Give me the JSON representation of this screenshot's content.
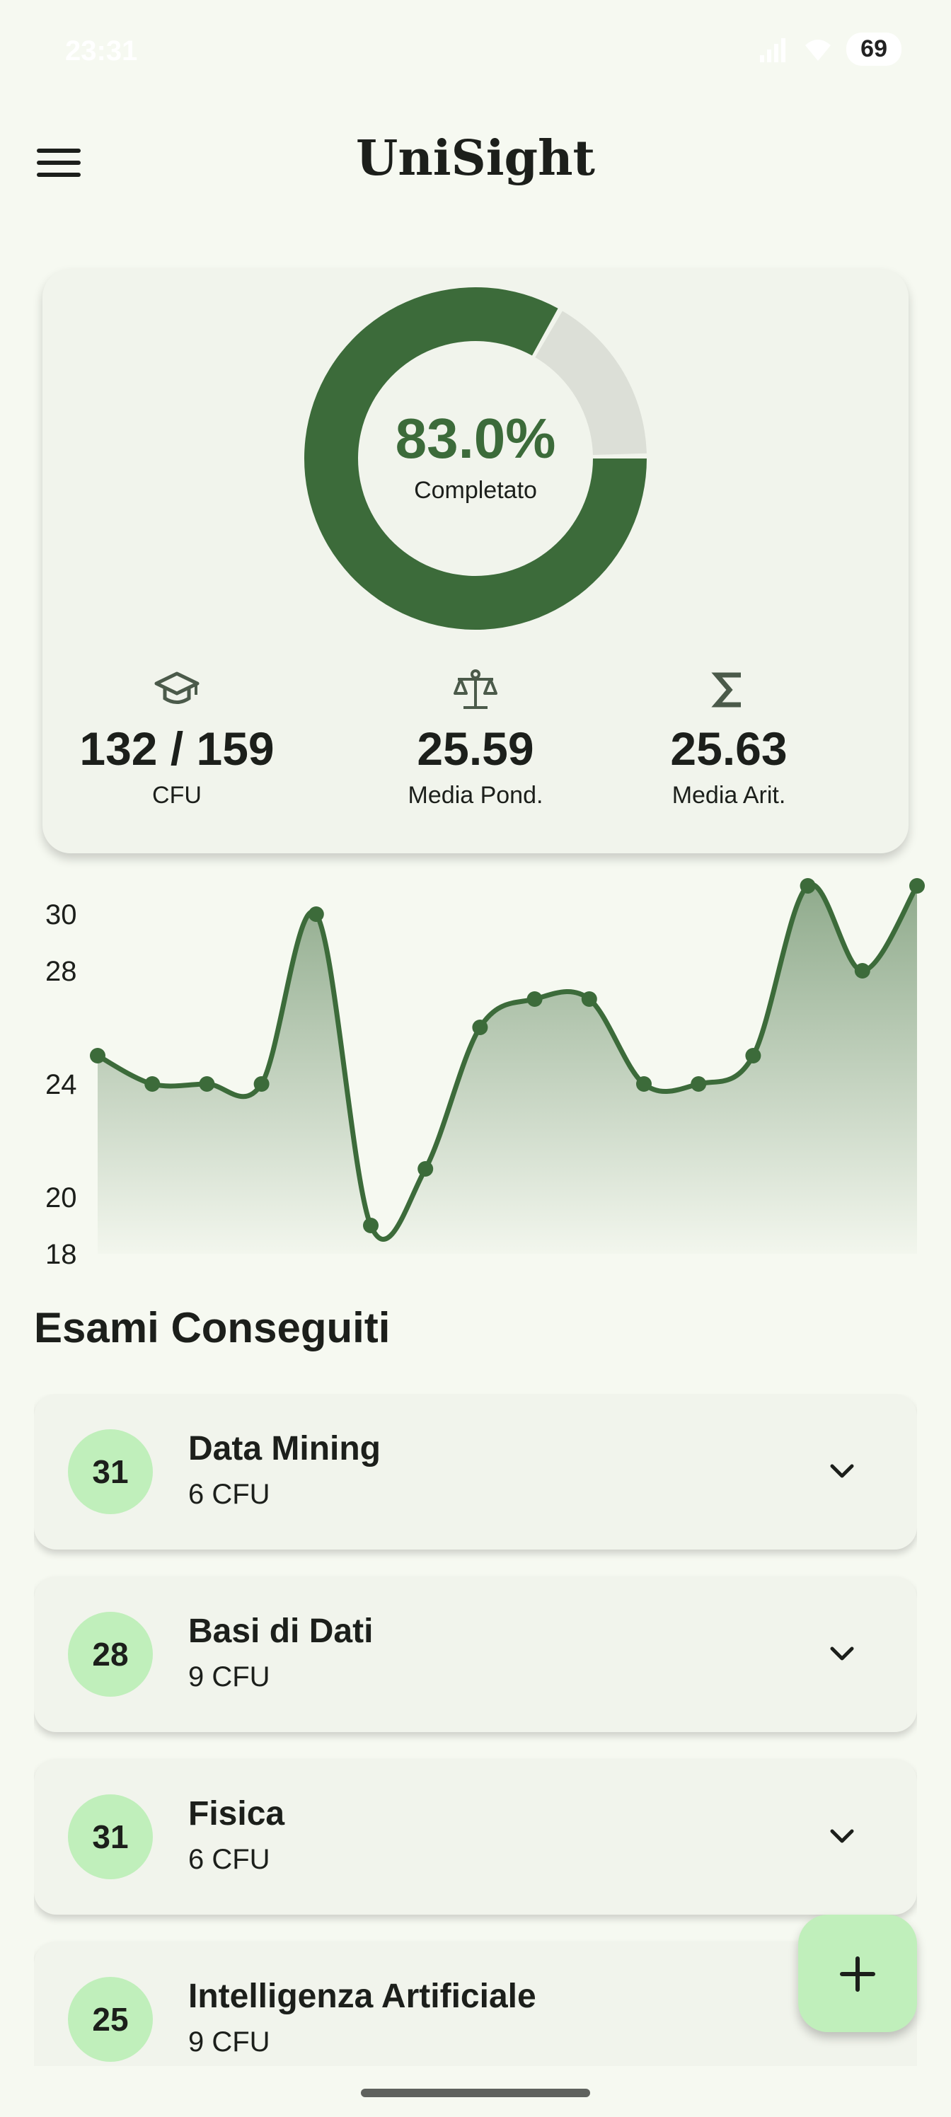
{
  "status_bar": {
    "time": "23:31",
    "battery": "69"
  },
  "header": {
    "title": "UniSight",
    "menu_icon": "menu-icon"
  },
  "summary": {
    "progress_percent": 83.0,
    "percent_text": "83.0%",
    "percent_label": "Completato",
    "stats": [
      {
        "icon": "graduation-cap-icon",
        "value": "132 / 159",
        "label": "CFU"
      },
      {
        "icon": "scale-icon",
        "value": "25.59",
        "label": "Media Pond."
      },
      {
        "icon": "sigma-icon",
        "value": "25.63",
        "label": "Media Arit."
      }
    ]
  },
  "chart_data": {
    "type": "line",
    "y_ticks": [
      18,
      20,
      24,
      28,
      30
    ],
    "ylim": [
      18,
      31
    ],
    "values": [
      25,
      24,
      24,
      24,
      30,
      19,
      21,
      26,
      27,
      27,
      24,
      24,
      25,
      31,
      28,
      31
    ],
    "color": "#3c6b3a",
    "area_fill": true,
    "grid": false
  },
  "exams": {
    "title": "Esami Conseguiti",
    "items": [
      {
        "grade": "31",
        "name": "Data Mining",
        "cfu": "6 CFU"
      },
      {
        "grade": "28",
        "name": "Basi di Dati",
        "cfu": "9 CFU"
      },
      {
        "grade": "31",
        "name": "Fisica",
        "cfu": "6 CFU"
      },
      {
        "grade": "25",
        "name": "Intelligenza Artificiale",
        "cfu": "9 CFU"
      }
    ]
  },
  "fab": {
    "icon": "plus-icon"
  },
  "colors": {
    "accent": "#3c6b3a",
    "badge": "#c0efbb",
    "background": "#f6f9f1",
    "card": "#f1f4ec",
    "track": "#dcdfd7"
  }
}
